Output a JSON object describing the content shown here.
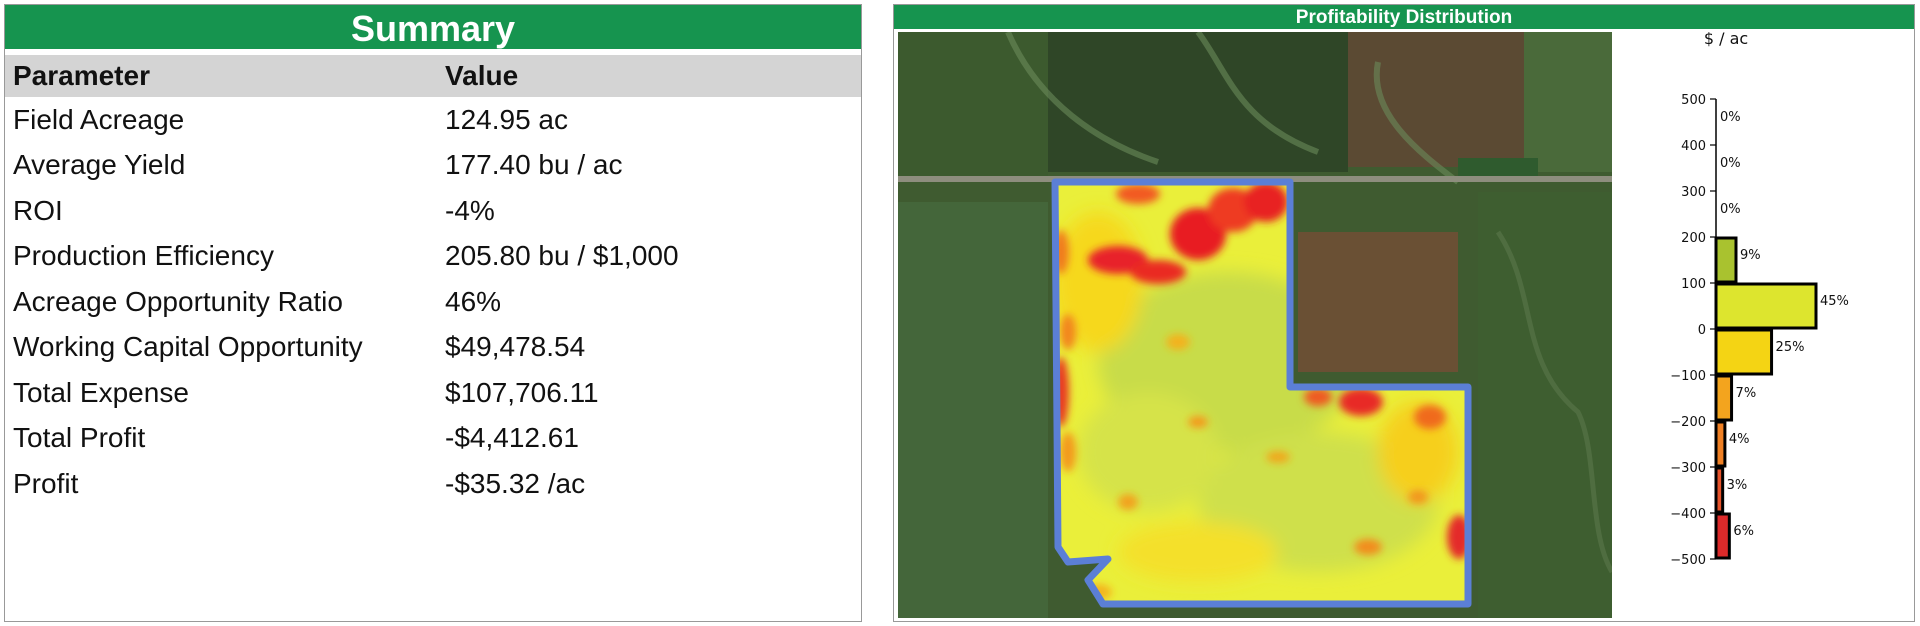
{
  "summary": {
    "title": "Summary",
    "columns": [
      "Parameter",
      "Value"
    ],
    "rows": [
      {
        "parameter": "Field Acreage",
        "value": "124.95 ac"
      },
      {
        "parameter": "Average Yield",
        "value": "177.40 bu / ac"
      },
      {
        "parameter": "ROI",
        "value": "-4%"
      },
      {
        "parameter": "Production Efficiency",
        "value": "205.80 bu / $1,000"
      },
      {
        "parameter": "Acreage Opportunity Ratio",
        "value": "46%"
      },
      {
        "parameter": "Working Capital Opportunity",
        "value": "$49,478.54"
      },
      {
        "parameter": "Total Expense",
        "value": "$107,706.11"
      },
      {
        "parameter": "Total Profit",
        "value": "-$4,412.61"
      },
      {
        "parameter": "Profit",
        "value": "-$35.32 /ac"
      }
    ]
  },
  "distribution": {
    "title": "Profitability Distribution"
  },
  "colors": {
    "header_green": "#16944f",
    "table_header_gray": "#d4d4d4",
    "field_outline": "#5b7fd6"
  },
  "chart_data": {
    "type": "bar",
    "orientation": "horizontal",
    "title": "Profitability Distribution",
    "ylabel": "$ / ac",
    "ylim": [
      -500,
      500
    ],
    "yticks": [
      "500",
      "400",
      "300",
      "200",
      "100",
      "0",
      "−100",
      "−200",
      "−300",
      "−400",
      "−500"
    ],
    "bins": [
      {
        "from": 400,
        "to": 500,
        "value": 0,
        "label": "0%",
        "color": "#2e9b2e"
      },
      {
        "from": 300,
        "to": 400,
        "value": 0,
        "label": "0%",
        "color": "#6aa428"
      },
      {
        "from": 200,
        "to": 300,
        "value": 0,
        "label": "0%",
        "color": "#8fb52a"
      },
      {
        "from": 100,
        "to": 200,
        "value": 9,
        "label": "9%",
        "color": "#a9c22f"
      },
      {
        "from": 0,
        "to": 100,
        "value": 45,
        "label": "45%",
        "color": "#dde52e"
      },
      {
        "from": -100,
        "to": 0,
        "value": 25,
        "label": "25%",
        "color": "#f4d414"
      },
      {
        "from": -200,
        "to": -100,
        "value": 7,
        "label": "7%",
        "color": "#f3a41e"
      },
      {
        "from": -300,
        "to": -200,
        "value": 4,
        "label": "4%",
        "color": "#ef8024"
      },
      {
        "from": -400,
        "to": -300,
        "value": 3,
        "label": "3%",
        "color": "#e5532b"
      },
      {
        "from": -500,
        "to": -400,
        "value": 6,
        "label": "6%",
        "color": "#dc2a2a"
      }
    ]
  }
}
